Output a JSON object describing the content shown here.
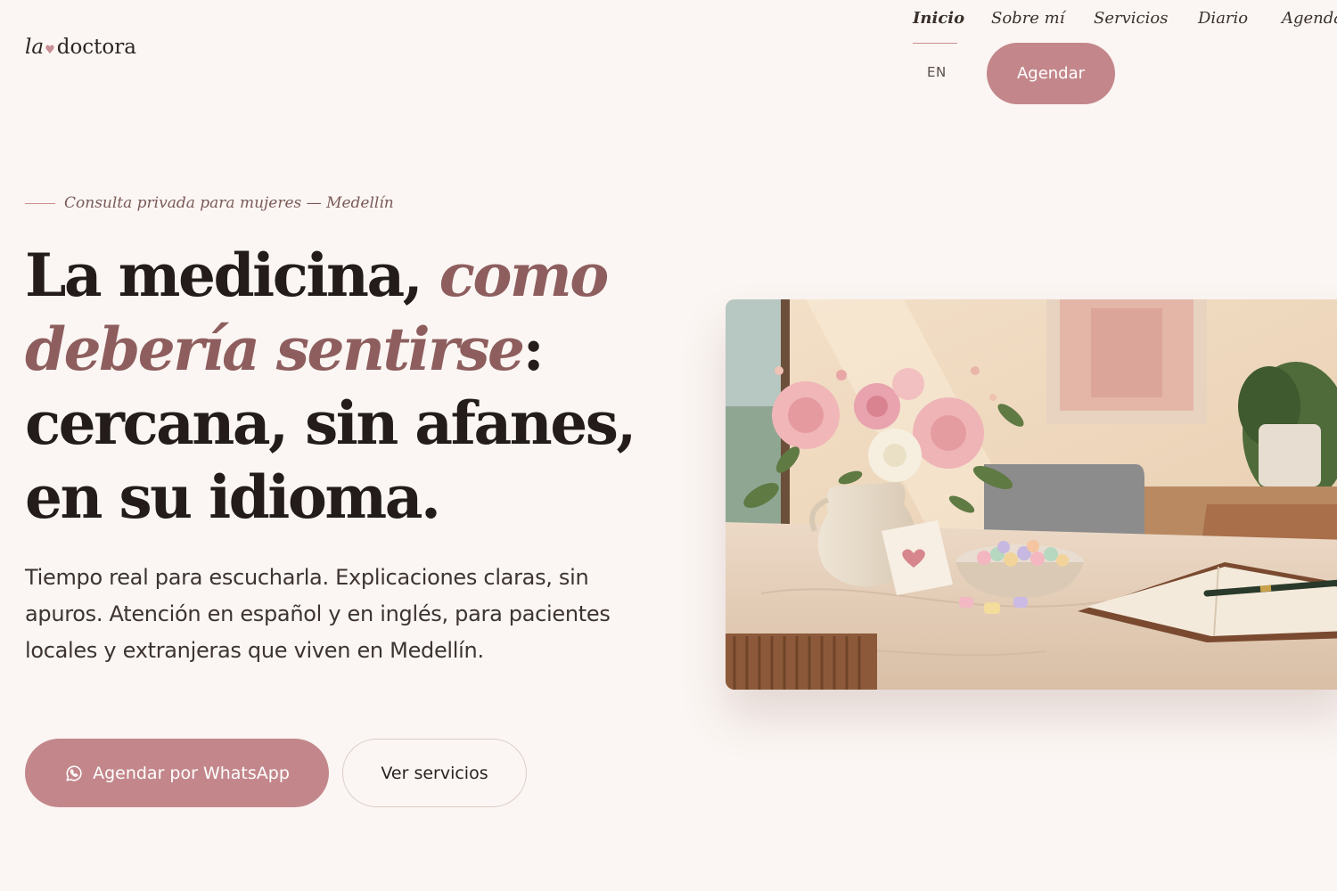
{
  "brand": {
    "logo_prefix": "la",
    "logo_suffix": "doctora"
  },
  "nav": {
    "items": [
      {
        "label": "Inicio",
        "active": true
      },
      {
        "label": "Sobre mí"
      },
      {
        "label": "Servicios"
      },
      {
        "label": "Diario"
      },
      {
        "label": "Agenda"
      }
    ],
    "lang_toggle": "EN",
    "cta": "Agendar"
  },
  "hero": {
    "eyebrow": "Consulta privada para mujeres — Medellín",
    "headline": {
      "part1": "La medicina, ",
      "accent1": "como",
      "accent2": "debería sentirse",
      "part2": ":",
      "line3": "cercana, sin afanes,",
      "line4": "en su idioma."
    },
    "lede": "Tiempo real para escucharla. Explicaciones claras, sin apuros. Atención en español y en inglés, para pacientes locales y extranjeras que viven en Medellín.",
    "primary_cta": "Agendar por WhatsApp",
    "secondary_cta": "Ver servicios",
    "image": {
      "subject": "consultorio con flores, jarrón, cuaderno y pluma sobre mesa de mármol"
    }
  },
  "colors": {
    "background": "#fbf6f3",
    "accent": "#c3878b",
    "accent_text": "#8e5e5e",
    "text": "#231c1a"
  },
  "icons": {
    "whatsapp": "whatsapp-icon",
    "heart": "heart-icon"
  }
}
